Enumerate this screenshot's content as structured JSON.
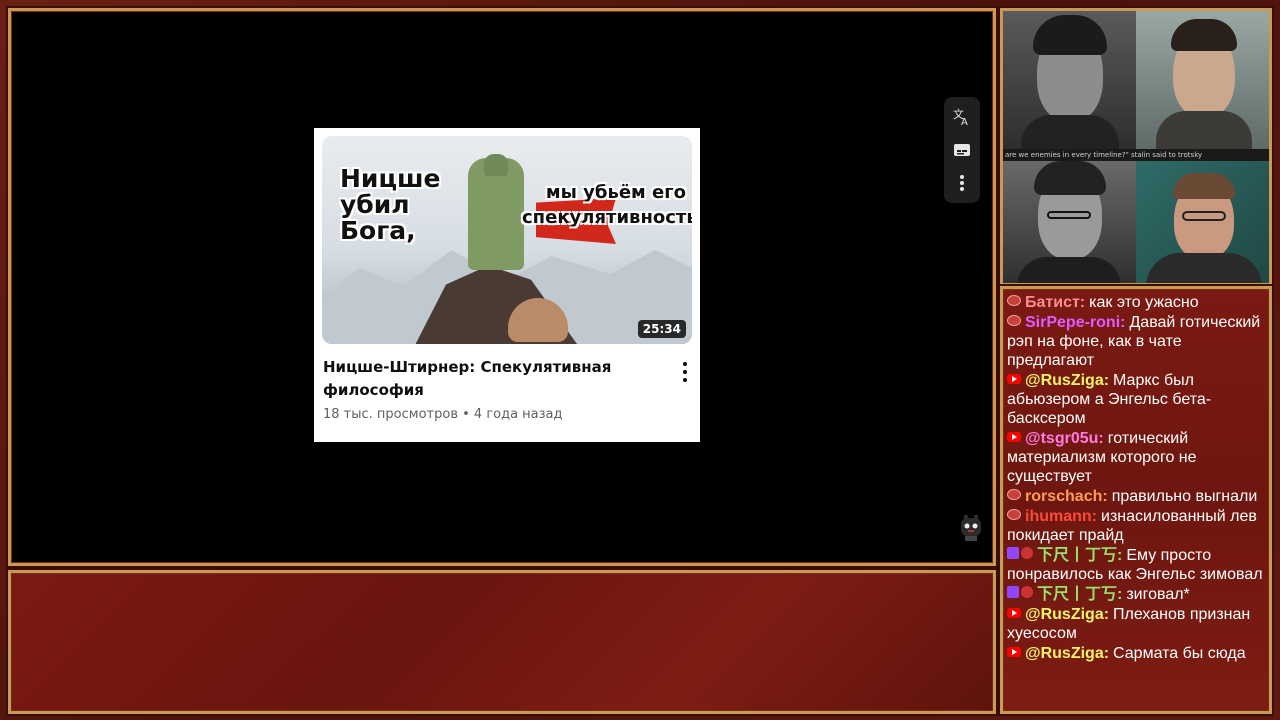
{
  "video_card": {
    "thumb_text_left": "Ницше убил Бога,",
    "thumb_text_right": "мы убьём его спекулятивность",
    "duration": "25:34",
    "title": "Ницше-Штирнер: Спекулятивная философия",
    "meta": "18 тыс. просмотров • 4 года назад"
  },
  "toolbar": {
    "translate_icon": "translate-icon",
    "subtitles_icon": "subtitles-icon",
    "more_icon": "more-vertical-icon"
  },
  "cam": {
    "caption": "are we enemies in every timeline?\" stalin said to trotsky"
  },
  "chat": [
    {
      "platform": "live",
      "user": "Батист:",
      "color": "#ff8c8c",
      "text": "как это ужасно"
    },
    {
      "platform": "live",
      "user": "SirPepe-roni:",
      "color": "#e05bff",
      "text": "Давай готический рэп на фоне, как в чате предлагают"
    },
    {
      "platform": "youtube",
      "user": "@RusZiga:",
      "color": "#f3f36a",
      "text": "Маркс был абьюзером а Энгельс бета-басксером"
    },
    {
      "platform": "youtube",
      "user": "@tsgr05u:",
      "color": "#ff7ae0",
      "text": "готический материализм которого не существует"
    },
    {
      "platform": "live",
      "user": "rorschach:",
      "color": "#ff9a55",
      "text": "правильно выгнали"
    },
    {
      "platform": "live",
      "user": "ihumann:",
      "color": "#ff4a3a",
      "text": "изнасилованный лев покидает прайд"
    },
    {
      "platform": "twitch",
      "user": "下尺丨丁丂:",
      "color": "#9be26a",
      "text": "Ему просто понравилось как Энгельс зимовал"
    },
    {
      "platform": "twitch",
      "user": "下尺丨丁丂:",
      "color": "#9be26a",
      "text": "зиговал*"
    },
    {
      "platform": "youtube",
      "user": "@RusZiga:",
      "color": "#f3f36a",
      "text": "Плеханов признан хуесосом"
    },
    {
      "platform": "youtube",
      "user": "@RusZiga:",
      "color": "#f3f36a",
      "text": "Сармата бы сюда"
    }
  ]
}
